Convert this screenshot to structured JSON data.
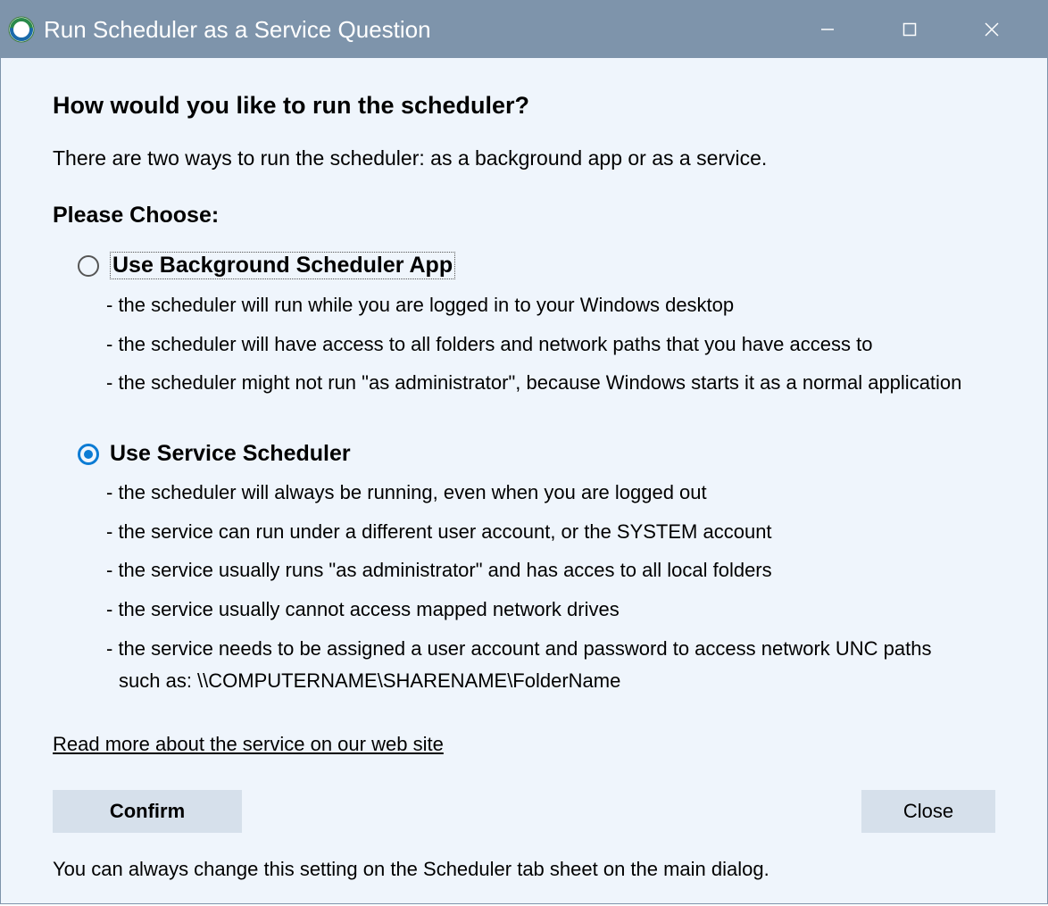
{
  "window": {
    "title": "Run Scheduler as a Service Question"
  },
  "content": {
    "heading": "How would you like to run the scheduler?",
    "intro": "There are two ways to run the scheduler: as a background app or as a service.",
    "subheading": "Please Choose:",
    "option1": {
      "title": "Use Background Scheduler App",
      "selected": false,
      "bullets": [
        "- the scheduler will run while you are logged in to your Windows desktop",
        "- the scheduler will have access to all folders and network paths that you have access to",
        "- the scheduler might not run \"as administrator\", because Windows starts it as a normal application"
      ]
    },
    "option2": {
      "title": "Use Service Scheduler",
      "selected": true,
      "bullets": [
        "- the scheduler will always be running, even when you are logged out",
        "- the service can run under a different user account, or the SYSTEM account",
        "- the service usually runs \"as administrator\" and has acces to all local folders",
        "- the service usually cannot access mapped network drives",
        "- the service needs to be assigned a user account and password to access network UNC paths"
      ],
      "bullet_cont": "such as: \\\\COMPUTERNAME\\SHARENAME\\FolderName"
    },
    "link": "Read more about the service on our web site",
    "buttons": {
      "confirm": "Confirm",
      "close": "Close"
    },
    "footer": "You can always change this setting on the Scheduler tab sheet on the main dialog."
  }
}
